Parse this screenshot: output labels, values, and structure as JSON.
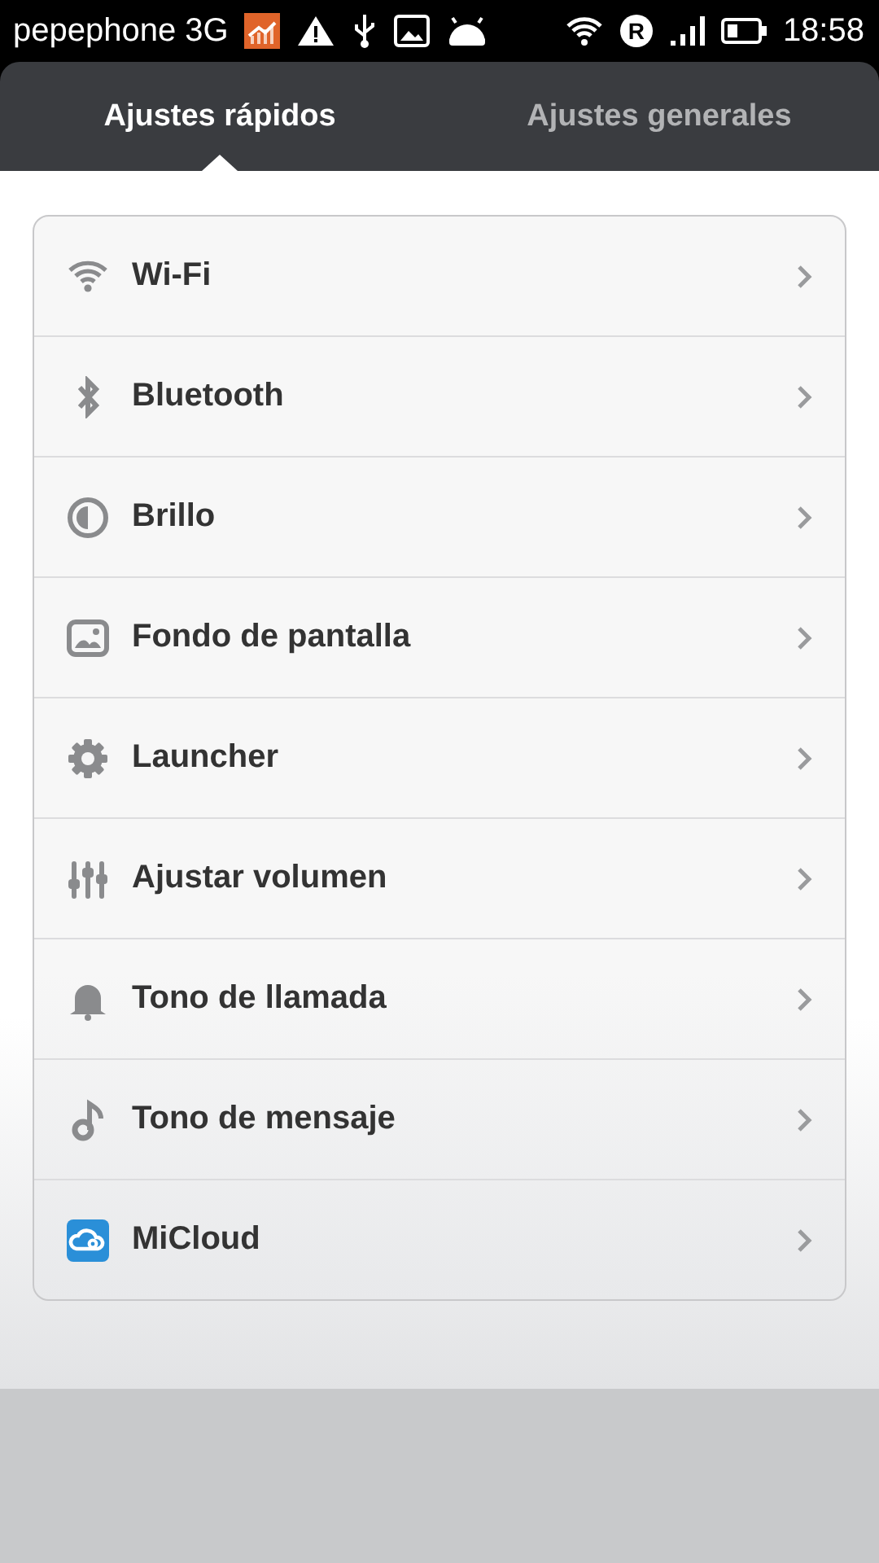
{
  "status_bar": {
    "carrier": "pepephone 3G",
    "roaming_badge": "R",
    "time": "18:58"
  },
  "tabs": [
    {
      "label": "Ajustes rápidos",
      "selected": true
    },
    {
      "label": "Ajustes generales",
      "selected": false
    }
  ],
  "items": [
    {
      "label": "Wi-Fi"
    },
    {
      "label": "Bluetooth"
    },
    {
      "label": "Brillo"
    },
    {
      "label": "Fondo de pantalla"
    },
    {
      "label": "Launcher"
    },
    {
      "label": "Ajustar volumen"
    },
    {
      "label": "Tono de llamada"
    },
    {
      "label": "Tono de mensaje"
    },
    {
      "label": "MiCloud"
    }
  ]
}
